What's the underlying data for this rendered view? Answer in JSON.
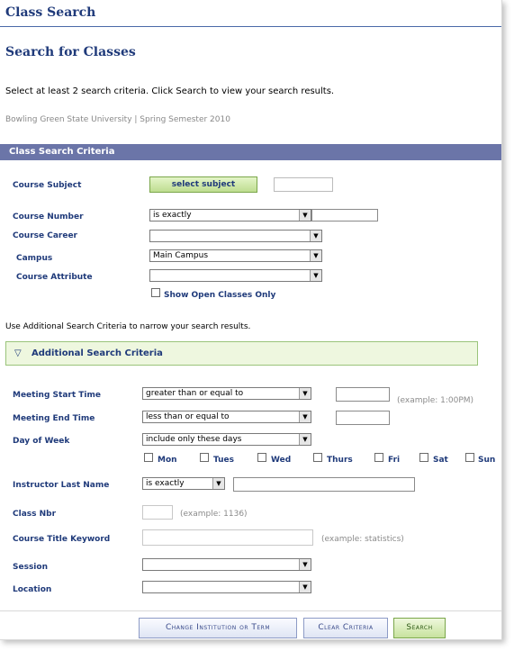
{
  "header": {
    "title": "Class Search",
    "subtitle": "Search for Classes"
  },
  "instructions": "Select at least 2 search criteria. Click Search to view your search results.",
  "institution_term": "Bowling Green State University | Spring Semester 2010",
  "criteria_bar": "Class Search Criteria",
  "fields": {
    "course_subject_label": "Course Subject",
    "select_subject_button": "select subject",
    "course_number_label": "Course Number",
    "course_number_operator": "is exactly",
    "course_career_label": "Course Career",
    "course_career_value": "",
    "campus_label": "Campus",
    "campus_value": "Main Campus",
    "course_attribute_label": "Course Attribute",
    "course_attribute_value": "",
    "open_classes_label": "Show Open Classes Only"
  },
  "additional_note": "Use Additional Search Criteria to narrow your search results.",
  "additional_header": "Additional Search Criteria",
  "additional": {
    "meeting_start_label": "Meeting Start Time",
    "meeting_start_operator": "greater than or equal to",
    "meeting_start_example": "(example: 1:00PM)",
    "meeting_end_label": "Meeting End Time",
    "meeting_end_operator": "less than or equal to",
    "day_of_week_label": "Day of Week",
    "day_of_week_operator": "include only these days",
    "days": [
      "Mon",
      "Tues",
      "Wed",
      "Thurs",
      "Fri",
      "Sat",
      "Sun"
    ],
    "instructor_label": "Instructor Last Name",
    "instructor_operator": "is exactly",
    "class_nbr_label": "Class Nbr",
    "class_nbr_example": "(example: 1136)",
    "title_keyword_label": "Course Title Keyword",
    "title_keyword_example": "(example: statistics)",
    "session_label": "Session",
    "session_value": "",
    "location_label": "Location",
    "location_value": ""
  },
  "buttons": {
    "change": "Change Institution or Term",
    "clear": "Clear Criteria",
    "search": "Search"
  }
}
